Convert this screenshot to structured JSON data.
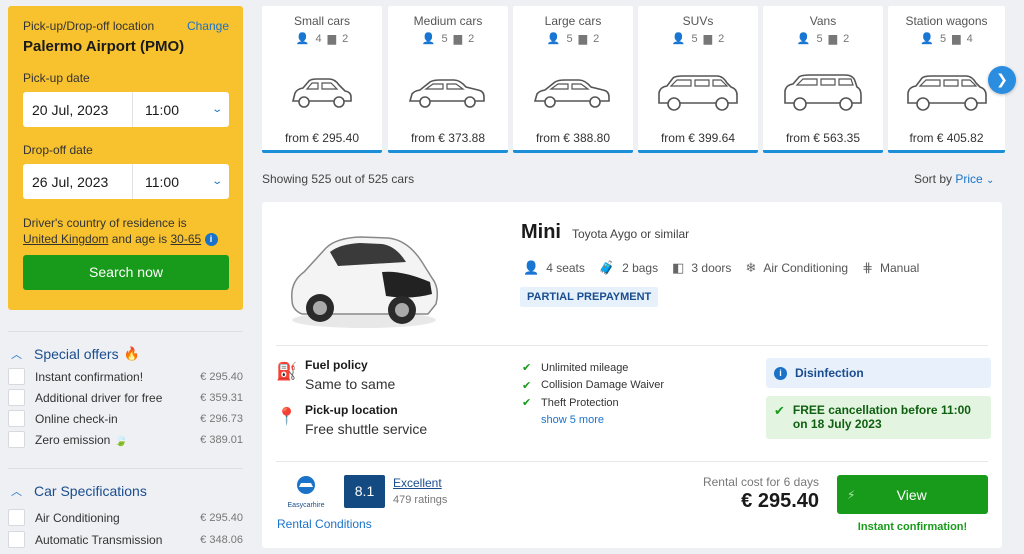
{
  "search": {
    "location_label": "Pick-up/Drop-off location",
    "change_label": "Change",
    "location": "Palermo Airport (PMO)",
    "pickup_label": "Pick-up date",
    "pickup_date": "20 Jul, 2023",
    "pickup_time": "11:00",
    "dropoff_label": "Drop-off date",
    "dropoff_date": "26 Jul, 2023",
    "dropoff_time": "11:00",
    "driver_text_1": "Driver's country of residence is",
    "driver_country": "United Kingdom",
    "driver_text_2": "and age is",
    "driver_age": "30-65",
    "search_button": "Search now"
  },
  "filters": [
    {
      "title": "Special offers",
      "items": [
        {
          "label": "Instant confirmation!",
          "price": "€ 295.40"
        },
        {
          "label": "Additional driver for free",
          "price": "€ 359.31"
        },
        {
          "label": "Online check-in",
          "price": "€ 296.73"
        },
        {
          "label": "Zero emission",
          "price": "€ 389.01"
        }
      ]
    },
    {
      "title": "Car Specifications",
      "items": [
        {
          "label": "Air Conditioning",
          "price": "€ 295.40"
        },
        {
          "label": "Automatic Transmission",
          "price": "€ 348.06"
        }
      ]
    }
  ],
  "categories": [
    {
      "name": "Small cars",
      "seats": "4",
      "bags": "2",
      "price": "from € 295.40"
    },
    {
      "name": "Medium cars",
      "seats": "5",
      "bags": "2",
      "price": "from € 373.88"
    },
    {
      "name": "Large cars",
      "seats": "5",
      "bags": "2",
      "price": "from € 388.80"
    },
    {
      "name": "SUVs",
      "seats": "5",
      "bags": "2",
      "price": "from € 399.64"
    },
    {
      "name": "Vans",
      "seats": "5",
      "bags": "2",
      "price": "from € 563.35"
    },
    {
      "name": "Station wagons",
      "seats": "5",
      "bags": "4",
      "price": "from € 405.82"
    }
  ],
  "results": {
    "showing": "Showing 525 out of 525 cars",
    "sort_label": "Sort by",
    "sort_value": "Price"
  },
  "card": {
    "title": "Mini",
    "similar": "Toyota Aygo or similar",
    "seats": "4 seats",
    "bags": "2 bags",
    "doors": "3 doors",
    "ac": "Air Conditioning",
    "transmission": "Manual",
    "prepayment": "PARTIAL PREPAYMENT",
    "fuel_title": "Fuel policy",
    "fuel_value": "Same to same",
    "pickup_title": "Pick-up location",
    "pickup_value": "Free shuttle service",
    "inclusions": [
      "Unlimited mileage",
      "Collision Damage Waiver",
      "Theft Protection"
    ],
    "show_more": "show 5 more",
    "disinfection": "Disinfection",
    "free_cancel": "FREE cancellation before 11:00 on 18 July 2023",
    "supplier": "Easycarhire",
    "score": "8.1",
    "rating_word": "Excellent",
    "rating_count": "479 ratings",
    "rental_conditions": "Rental Conditions",
    "rental_cost_label": "Rental cost for 6 days",
    "price": "€ 295.40",
    "view_button": "View",
    "instant": "Instant confirmation!"
  },
  "colors": {
    "accent": "#1a73c9",
    "search_bg": "#f7c22e",
    "button_green": "#189a1a",
    "score_bg": "#144a82"
  }
}
